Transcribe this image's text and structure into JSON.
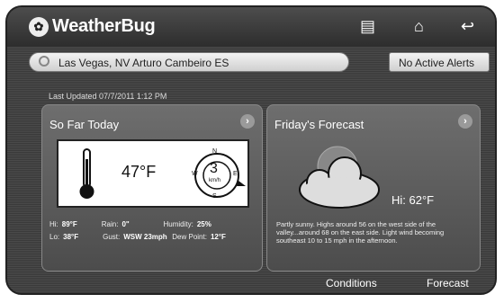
{
  "app": {
    "title": "WeatherBug",
    "logo_glyph": "✿"
  },
  "header_icons": [
    {
      "name": "notes-icon",
      "glyph": "▤"
    },
    {
      "name": "home-icon",
      "glyph": "⌂"
    },
    {
      "name": "back-icon",
      "glyph": "↩"
    }
  ],
  "location": "Las Vegas, NV Arturo Cambeiro ES",
  "alerts": "No Active Alerts",
  "last_updated": "Last Updated 07/7/2011 1:12 PM",
  "so_far_today": {
    "title": "So Far Today",
    "temperature": "47°F",
    "wind_speed": "3",
    "wind_unit": "km/h",
    "compass": {
      "n": "N",
      "s": "S",
      "e": "E",
      "w": "W"
    },
    "stats": {
      "hi_label": "Hi:",
      "hi": "89°F",
      "rain_label": "Rain:",
      "rain": "0\"",
      "humidity_label": "Humidity:",
      "humidity": "25%",
      "lo_label": "Lo:",
      "lo": "38°F",
      "gust_label": "Gust:",
      "gust": "WSW 23mph",
      "dew_label": "Dew Point:",
      "dew": "12°F"
    }
  },
  "forecast": {
    "title": "Friday's Forecast",
    "hi": "Hi: 62°F",
    "description": "Partly sunny. Highs around 56 on the west side of the valley...around 68 on the east side. Light wind becoming southeast 10 to 15 mph in the afternoon."
  },
  "tabs": {
    "conditions": "Conditions",
    "forecast": "Forecast"
  },
  "colors": {
    "background": "#3f3f3f",
    "panel": "#5e5e5e",
    "accent": "#ffffff"
  }
}
